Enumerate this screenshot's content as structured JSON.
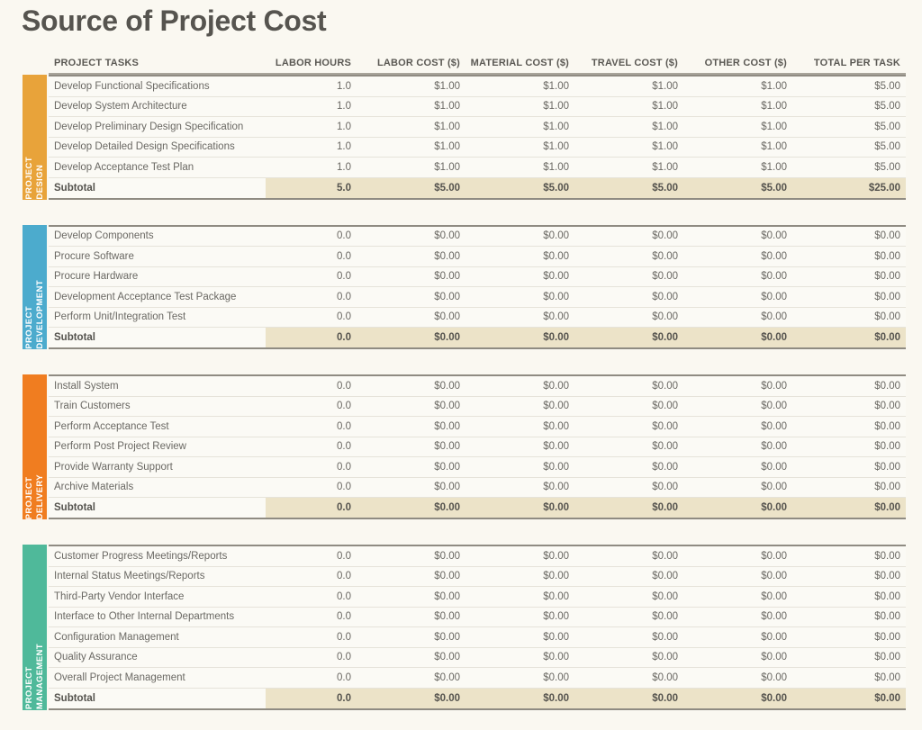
{
  "page": {
    "title": "Source of Project Cost",
    "background_color": "#faf8f1",
    "title_color": "#56544f",
    "subtotal_highlight_color": "#ece3c8"
  },
  "table": {
    "columns": [
      {
        "key": "task",
        "label": "PROJECT TASKS",
        "align": "left"
      },
      {
        "key": "hours",
        "label": "LABOR HOURS",
        "align": "right"
      },
      {
        "key": "labor",
        "label": "LABOR COST ($)",
        "align": "right"
      },
      {
        "key": "material",
        "label": "MATERIAL COST ($)",
        "align": "right"
      },
      {
        "key": "travel",
        "label": "TRAVEL COST ($)",
        "align": "right"
      },
      {
        "key": "other",
        "label": "OTHER COST ($)",
        "align": "right"
      },
      {
        "key": "total",
        "label": "TOTAL PER TASK",
        "align": "right"
      }
    ],
    "subtotal_label": "Subtotal",
    "sections": [
      {
        "name": "PROJECT DESIGN",
        "tab_label_lines": [
          "PROJECT",
          "DESIGN"
        ],
        "tab_color": "#e8a33a",
        "rows": [
          {
            "task": "Develop Functional Specifications",
            "hours": "1.0",
            "labor": "$1.00",
            "material": "$1.00",
            "travel": "$1.00",
            "other": "$1.00",
            "total": "$5.00"
          },
          {
            "task": "Develop System Architecture",
            "hours": "1.0",
            "labor": "$1.00",
            "material": "$1.00",
            "travel": "$1.00",
            "other": "$1.00",
            "total": "$5.00"
          },
          {
            "task": "Develop Preliminary Design Specification",
            "hours": "1.0",
            "labor": "$1.00",
            "material": "$1.00",
            "travel": "$1.00",
            "other": "$1.00",
            "total": "$5.00"
          },
          {
            "task": "Develop Detailed Design Specifications",
            "hours": "1.0",
            "labor": "$1.00",
            "material": "$1.00",
            "travel": "$1.00",
            "other": "$1.00",
            "total": "$5.00"
          },
          {
            "task": "Develop Acceptance Test Plan",
            "hours": "1.0",
            "labor": "$1.00",
            "material": "$1.00",
            "travel": "$1.00",
            "other": "$1.00",
            "total": "$5.00"
          }
        ],
        "subtotal": {
          "task": "Subtotal",
          "hours": "5.0",
          "labor": "$5.00",
          "material": "$5.00",
          "travel": "$5.00",
          "other": "$5.00",
          "total": "$25.00"
        }
      },
      {
        "name": "PROJECT DEVELOPMENT",
        "tab_label_lines": [
          "PROJECT",
          "DEVELOPMENT"
        ],
        "tab_color": "#4cabcd",
        "rows": [
          {
            "task": "Develop Components",
            "hours": "0.0",
            "labor": "$0.00",
            "material": "$0.00",
            "travel": "$0.00",
            "other": "$0.00",
            "total": "$0.00"
          },
          {
            "task": "Procure Software",
            "hours": "0.0",
            "labor": "$0.00",
            "material": "$0.00",
            "travel": "$0.00",
            "other": "$0.00",
            "total": "$0.00"
          },
          {
            "task": "Procure Hardware",
            "hours": "0.0",
            "labor": "$0.00",
            "material": "$0.00",
            "travel": "$0.00",
            "other": "$0.00",
            "total": "$0.00"
          },
          {
            "task": "Development Acceptance Test Package",
            "hours": "0.0",
            "labor": "$0.00",
            "material": "$0.00",
            "travel": "$0.00",
            "other": "$0.00",
            "total": "$0.00"
          },
          {
            "task": "Perform Unit/Integration Test",
            "hours": "0.0",
            "labor": "$0.00",
            "material": "$0.00",
            "travel": "$0.00",
            "other": "$0.00",
            "total": "$0.00"
          }
        ],
        "subtotal": {
          "task": "Subtotal",
          "hours": "0.0",
          "labor": "$0.00",
          "material": "$0.00",
          "travel": "$0.00",
          "other": "$0.00",
          "total": "$0.00"
        }
      },
      {
        "name": "PROJECT DELIVERY",
        "tab_label_lines": [
          "PROJECT",
          "DELIVERY"
        ],
        "tab_color": "#f07d20",
        "rows": [
          {
            "task": "Install System",
            "hours": "0.0",
            "labor": "$0.00",
            "material": "$0.00",
            "travel": "$0.00",
            "other": "$0.00",
            "total": "$0.00"
          },
          {
            "task": "Train Customers",
            "hours": "0.0",
            "labor": "$0.00",
            "material": "$0.00",
            "travel": "$0.00",
            "other": "$0.00",
            "total": "$0.00"
          },
          {
            "task": "Perform Acceptance Test",
            "hours": "0.0",
            "labor": "$0.00",
            "material": "$0.00",
            "travel": "$0.00",
            "other": "$0.00",
            "total": "$0.00"
          },
          {
            "task": "Perform Post Project Review",
            "hours": "0.0",
            "labor": "$0.00",
            "material": "$0.00",
            "travel": "$0.00",
            "other": "$0.00",
            "total": "$0.00"
          },
          {
            "task": "Provide Warranty Support",
            "hours": "0.0",
            "labor": "$0.00",
            "material": "$0.00",
            "travel": "$0.00",
            "other": "$0.00",
            "total": "$0.00"
          },
          {
            "task": "Archive Materials",
            "hours": "0.0",
            "labor": "$0.00",
            "material": "$0.00",
            "travel": "$0.00",
            "other": "$0.00",
            "total": "$0.00"
          }
        ],
        "subtotal": {
          "task": "Subtotal",
          "hours": "0.0",
          "labor": "$0.00",
          "material": "$0.00",
          "travel": "$0.00",
          "other": "$0.00",
          "total": "$0.00"
        }
      },
      {
        "name": "PROJECT MANAGEMENT",
        "tab_label_lines": [
          "PROJECT",
          "MANAGEMENT"
        ],
        "tab_color": "#4fb99a",
        "rows": [
          {
            "task": "Customer Progress Meetings/Reports",
            "hours": "0.0",
            "labor": "$0.00",
            "material": "$0.00",
            "travel": "$0.00",
            "other": "$0.00",
            "total": "$0.00"
          },
          {
            "task": "Internal Status Meetings/Reports",
            "hours": "0.0",
            "labor": "$0.00",
            "material": "$0.00",
            "travel": "$0.00",
            "other": "$0.00",
            "total": "$0.00"
          },
          {
            "task": "Third-Party Vendor Interface",
            "hours": "0.0",
            "labor": "$0.00",
            "material": "$0.00",
            "travel": "$0.00",
            "other": "$0.00",
            "total": "$0.00"
          },
          {
            "task": "Interface to Other Internal Departments",
            "hours": "0.0",
            "labor": "$0.00",
            "material": "$0.00",
            "travel": "$0.00",
            "other": "$0.00",
            "total": "$0.00"
          },
          {
            "task": "Configuration Management",
            "hours": "0.0",
            "labor": "$0.00",
            "material": "$0.00",
            "travel": "$0.00",
            "other": "$0.00",
            "total": "$0.00"
          },
          {
            "task": "Quality Assurance",
            "hours": "0.0",
            "labor": "$0.00",
            "material": "$0.00",
            "travel": "$0.00",
            "other": "$0.00",
            "total": "$0.00"
          },
          {
            "task": "Overall Project Management",
            "hours": "0.0",
            "labor": "$0.00",
            "material": "$0.00",
            "travel": "$0.00",
            "other": "$0.00",
            "total": "$0.00"
          }
        ],
        "subtotal": {
          "task": "Subtotal",
          "hours": "0.0",
          "labor": "$0.00",
          "material": "$0.00",
          "travel": "$0.00",
          "other": "$0.00",
          "total": "$0.00"
        }
      }
    ]
  }
}
